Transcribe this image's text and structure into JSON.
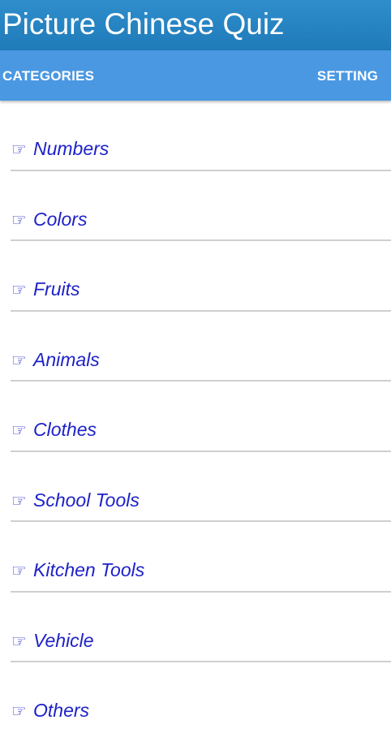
{
  "app": {
    "title": "Picture Chinese Quiz"
  },
  "tabs": [
    {
      "label": "CATEGORIES"
    },
    {
      "label": "SETTING"
    }
  ],
  "categories": {
    "icon": "pointing-hand-icon",
    "icon_glyph": "☞",
    "text_color": "#1e22c8",
    "items": [
      {
        "label": "Numbers"
      },
      {
        "label": "Colors"
      },
      {
        "label": "Fruits"
      },
      {
        "label": "Animals"
      },
      {
        "label": "Clothes"
      },
      {
        "label": "School Tools"
      },
      {
        "label": "Kitchen Tools"
      },
      {
        "label": "Vehicle"
      },
      {
        "label": "Others"
      }
    ]
  },
  "colors": {
    "app_bar": "#1f7ab8",
    "tab_bar": "#4a98e2",
    "divider": "#cfcfcf"
  }
}
